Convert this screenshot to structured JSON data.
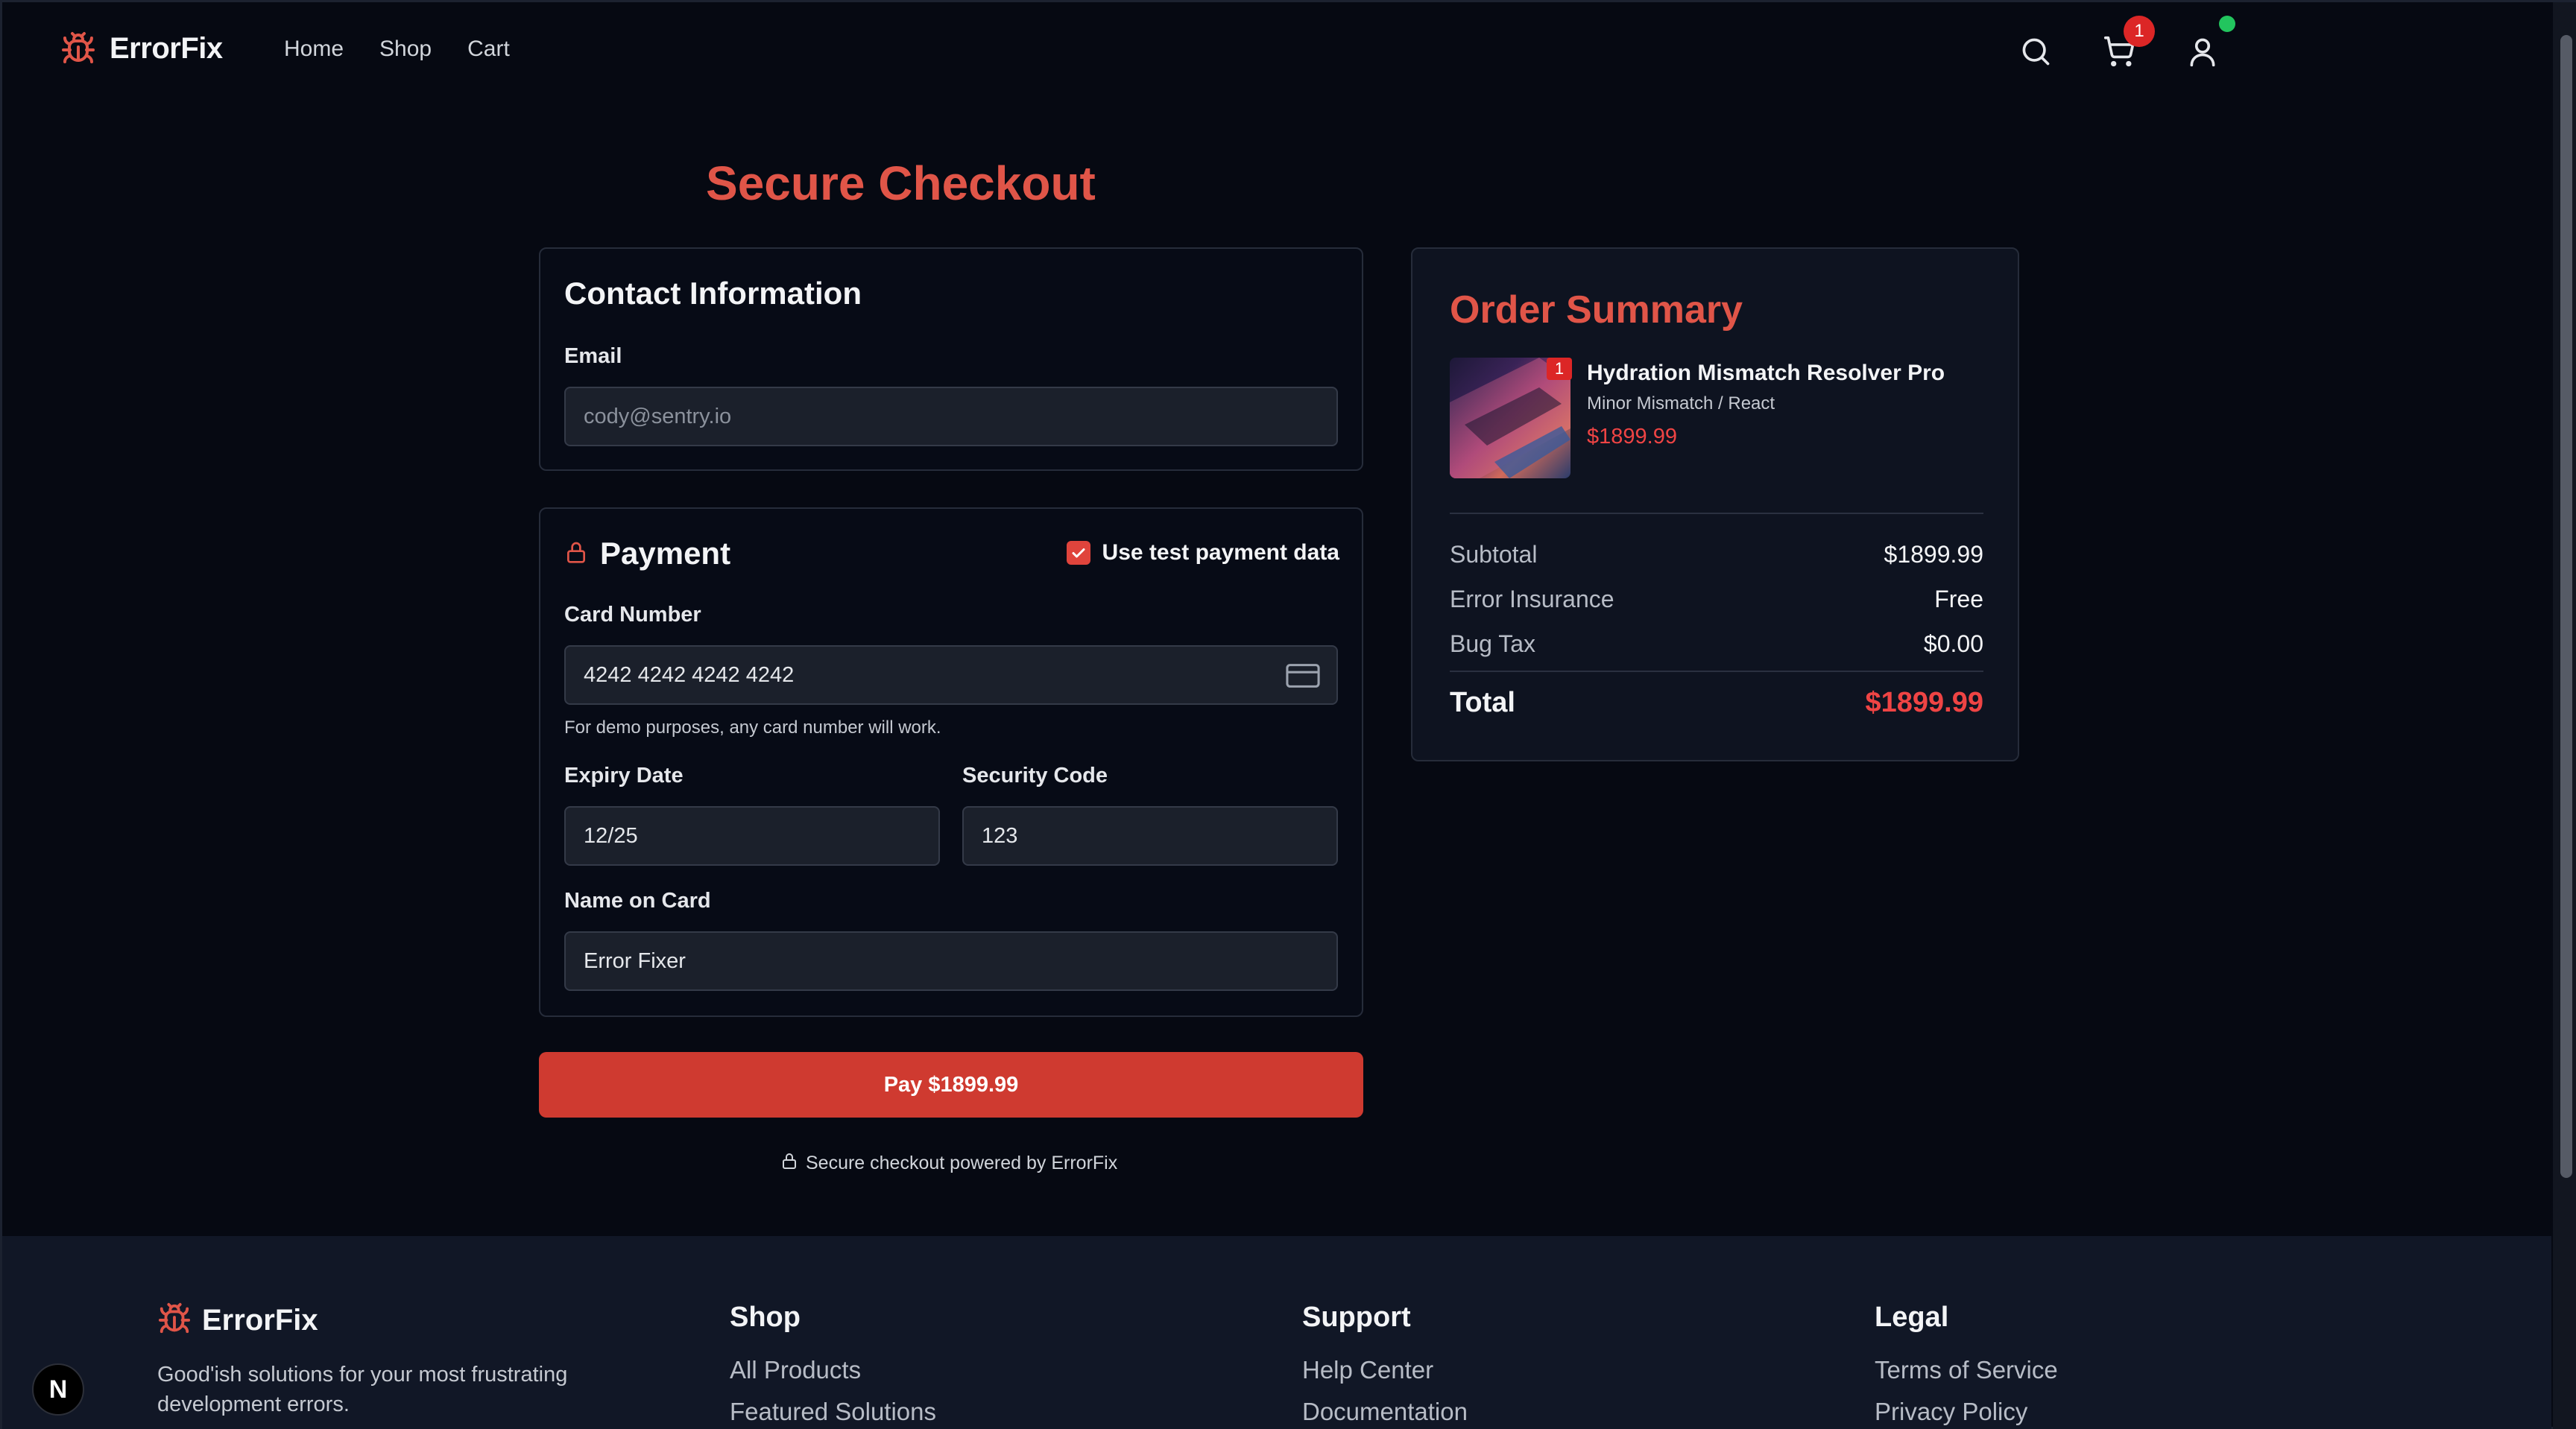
{
  "brand": {
    "name": "ErrorFix"
  },
  "nav": {
    "links": [
      "Home",
      "Shop",
      "Cart"
    ],
    "cart_count": "1",
    "icons": [
      "search-icon",
      "cart-icon",
      "user-icon"
    ]
  },
  "page_title": "Secure Checkout",
  "contact": {
    "heading": "Contact Information",
    "email_label": "Email",
    "email_placeholder": "cody@sentry.io"
  },
  "payment": {
    "heading": "Payment",
    "test_data_label": "Use test payment data",
    "test_data_checked": true,
    "card_number_label": "Card Number",
    "card_number_value": "4242 4242 4242 4242",
    "card_hint": "For demo purposes, any card number will work.",
    "expiry_label": "Expiry Date",
    "expiry_value": "12/25",
    "cvc_label": "Security Code",
    "cvc_value": "123",
    "name_label": "Name on Card",
    "name_value": "Error Fixer",
    "pay_button": "Pay $1899.99",
    "secure_note": "Secure checkout powered by ErrorFix"
  },
  "summary": {
    "title": "Order Summary",
    "item": {
      "name": "Hydration Mismatch Resolver Pro",
      "variant": "Minor Mismatch / React",
      "price": "$1899.99",
      "qty": "1"
    },
    "subtotal_label": "Subtotal",
    "subtotal_value": "$1899.99",
    "insurance_label": "Error Insurance",
    "insurance_value": "Free",
    "tax_label": "Bug Tax",
    "tax_value": "$0.00",
    "total_label": "Total",
    "total_value": "$1899.99"
  },
  "footer": {
    "brand": "ErrorFix",
    "description": "Good'ish solutions for your most frustrating development errors.",
    "shop": {
      "title": "Shop",
      "links": [
        "All Products",
        "Featured Solutions"
      ]
    },
    "support": {
      "title": "Support",
      "links": [
        "Help Center",
        "Documentation"
      ]
    },
    "legal": {
      "title": "Legal",
      "links": [
        "Terms of Service",
        "Privacy Policy"
      ]
    }
  },
  "dev_badge": "N",
  "colors": {
    "accent": "#e05548",
    "button": "#cf3a30",
    "background": "#060912",
    "success": "#22c55e"
  }
}
